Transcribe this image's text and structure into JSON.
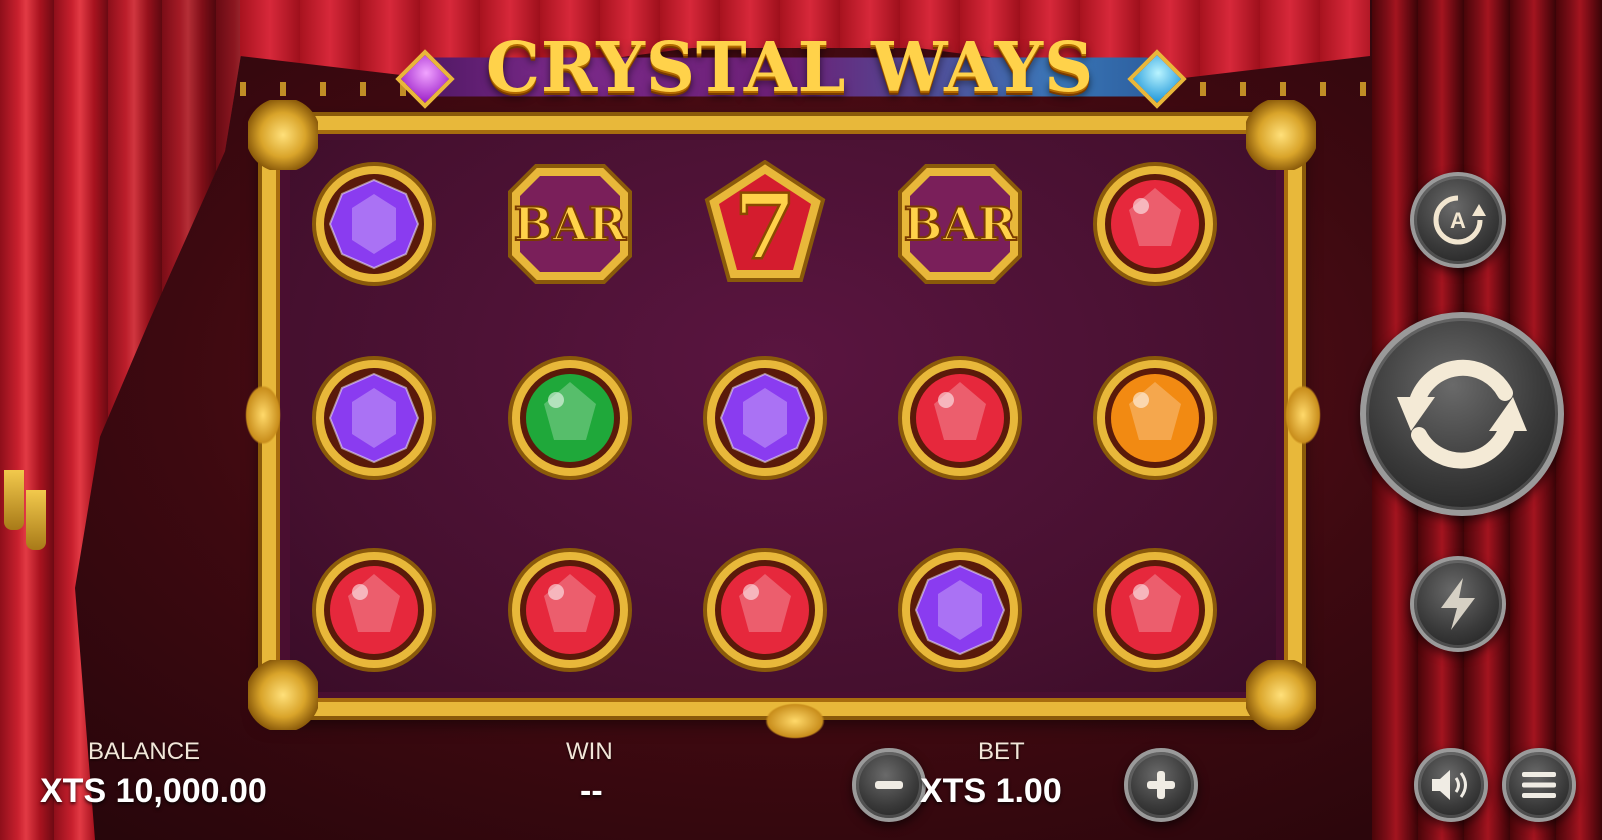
{
  "title": "CRYSTAL WAYS",
  "reels": [
    [
      "purple-gem",
      "bar",
      "seven",
      "bar",
      "red-gem"
    ],
    [
      "purple-gem",
      "green-gem",
      "purple-gem",
      "red-gem",
      "orange-gem"
    ],
    [
      "red-gem",
      "red-gem",
      "red-gem",
      "purple-gem",
      "red-gem"
    ]
  ],
  "symbol_text": {
    "bar": "BAR",
    "seven": "7"
  },
  "colors": {
    "purple-gem": "#8a3cf0",
    "green-gem": "#1fa83a",
    "red-gem": "#e6283c",
    "orange-gem": "#f28a12",
    "gold": "#e8b83a",
    "reel_bg": "#4a0e30"
  },
  "controls": {
    "autoplay_icon": "autoplay-icon",
    "autoplay_letter": "A",
    "spin_icon": "spin-arrows-icon",
    "turbo_icon": "lightning-icon",
    "sound_icon": "speaker-icon",
    "menu_icon": "hamburger-menu-icon",
    "minus_icon": "minus-icon",
    "plus_icon": "plus-icon"
  },
  "status": {
    "balance_label": "BALANCE",
    "balance_value": "XTS 10,000.00",
    "win_label": "WIN",
    "win_value": "--",
    "bet_label": "BET",
    "bet_value": "XTS 1.00"
  }
}
